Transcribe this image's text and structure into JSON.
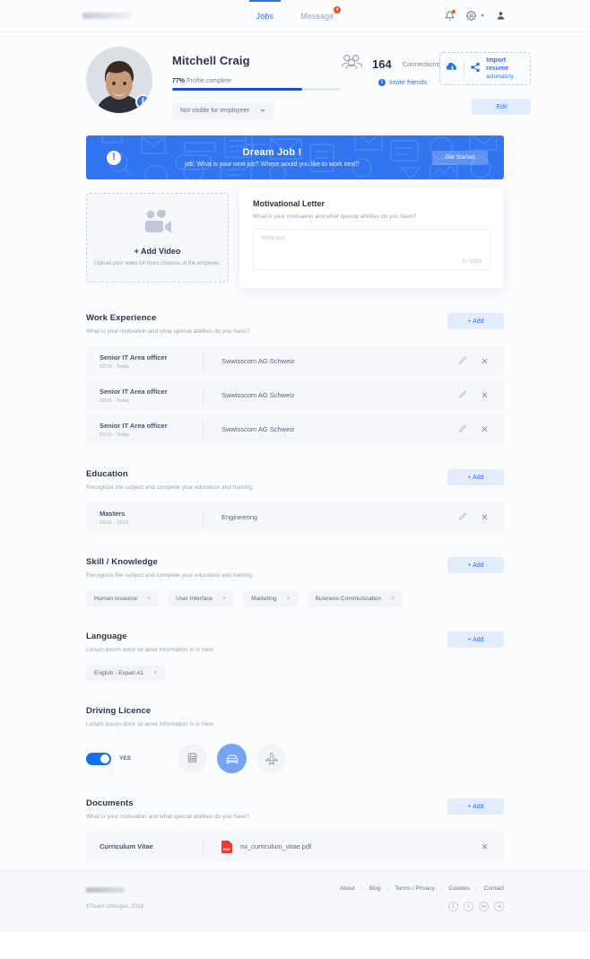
{
  "nav": {
    "logo": "logo-placeholder",
    "tabs": [
      {
        "label": "Jobs",
        "active": true,
        "badge": ""
      },
      {
        "label": "Message",
        "active": false,
        "badge": "4"
      }
    ],
    "icons": [
      "bell-icon",
      "gear-icon",
      "avatar-icon"
    ]
  },
  "profile": {
    "name": "Mitchell Craig",
    "percent_label": "77%",
    "complete_label": "Profile complete",
    "percent_value": 77,
    "visibility_select": "Not visible for employeer",
    "connections_count": "164",
    "connections_label": "Connections",
    "invite_label": "Invite friends",
    "import_line1": "Import resume",
    "import_line2": "automaticly",
    "edit_label": "Edit",
    "social_badge": "f"
  },
  "banner": {
    "title": "Dream Job !",
    "subtitle": "job, What is your next job? Where would  you like to work next?",
    "button": "Get Started",
    "accent": "#3275f0"
  },
  "video": {
    "add_label": "+ Add Video",
    "hint": "Upload your video for more chances at the employer."
  },
  "letter": {
    "title": "Motivational Letter",
    "subtitle": "What is your motivation and what special abilities do you have?",
    "placeholder": "Write text",
    "counter": "0 / 1800"
  },
  "work": {
    "title": "Work Experience",
    "subtitle": "What is your motivation and what special abilities do you have?",
    "add_label": "+ Add",
    "rows": [
      {
        "title": "Senior IT Area officer",
        "date": "02/16 - Today",
        "value": "Swwisscom AG Schweiz"
      },
      {
        "title": "Senior IT Area officer",
        "date": "02/16 - Today",
        "value": "Swwisscom AG Schweiz"
      },
      {
        "title": "Senior IT Area officer",
        "date": "02/16 - Today",
        "value": "Swwisscom AG Schweiz"
      }
    ]
  },
  "education": {
    "title": "Education",
    "subtitle": "Recognize the subject and complete your education and training.",
    "add_label": "+ Add",
    "rows": [
      {
        "title": "Masters",
        "date": "02/16 - 12/15",
        "value": "Engineering"
      }
    ]
  },
  "skill": {
    "title": "Skill / Knowledge",
    "subtitle": "Recognize the subject and complete your education and training.",
    "add_label": "+ Add",
    "tags": [
      "Human resource",
      "User Interface",
      "Marketing",
      "Business Communication"
    ]
  },
  "language": {
    "title": "Language",
    "subtitle": "Loriam ipsom dolor sit amet information is in here",
    "add_label": "+ Add",
    "tags": [
      "English - Expart A1"
    ]
  },
  "driving": {
    "title": "Driving Licence",
    "subtitle": "Loriam ipsom dolor sit amet information is in here",
    "toggle_label": "YES",
    "toggle_on": true,
    "vehicles": [
      {
        "name": "bus-icon",
        "selected": false
      },
      {
        "name": "car-icon",
        "selected": true
      },
      {
        "name": "plane-icon",
        "selected": false
      }
    ]
  },
  "documents": {
    "title": "Documents",
    "subtitle": "What is your motivation and what special abilities do you have?",
    "add_label": "+ Add",
    "rows": [
      {
        "label": "Curriculum Vitae",
        "file": "mi_curriculum_vitae.pdf",
        "type": "PDF"
      }
    ]
  },
  "footer": {
    "copyright": "©Team UINuget, 2018",
    "links": [
      "About",
      "Blog",
      "Terms / Privacy",
      "Cookies",
      "Contact"
    ],
    "social": [
      "f",
      "t",
      "in",
      "◂"
    ]
  }
}
